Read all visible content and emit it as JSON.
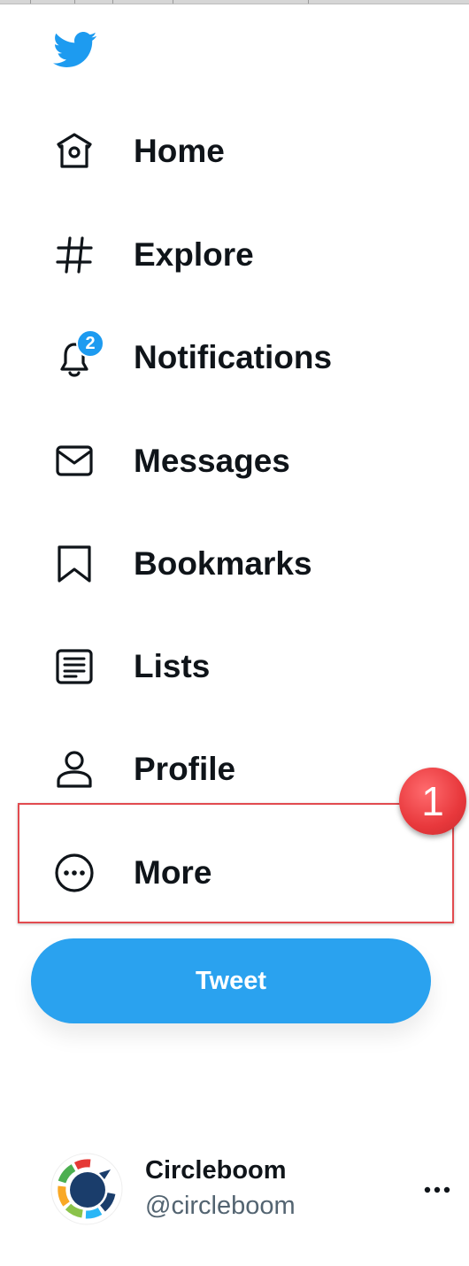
{
  "colors": {
    "brand_blue": "#1d9bf0",
    "tweet_button": "#2aa2ef",
    "text_primary": "#0f1419",
    "text_secondary": "#536471",
    "annotation_red": "#e24b4f"
  },
  "logo": {
    "icon": "twitter-bird-icon"
  },
  "nav": {
    "items": [
      {
        "label": "Home",
        "icon": "home-icon"
      },
      {
        "label": "Explore",
        "icon": "hashtag-icon"
      },
      {
        "label": "Notifications",
        "icon": "bell-icon",
        "badge": "2"
      },
      {
        "label": "Messages",
        "icon": "envelope-icon"
      },
      {
        "label": "Bookmarks",
        "icon": "bookmark-icon"
      },
      {
        "label": "Lists",
        "icon": "list-icon"
      },
      {
        "label": "Profile",
        "icon": "person-icon"
      },
      {
        "label": "More",
        "icon": "more-circle-icon"
      }
    ]
  },
  "annotation": {
    "step": "1"
  },
  "tweet_button": {
    "label": "Tweet"
  },
  "account": {
    "name": "Circleboom",
    "handle": "@circleboom",
    "avatar_icon": "circleboom-logo",
    "more_icon": "ellipsis-icon"
  }
}
